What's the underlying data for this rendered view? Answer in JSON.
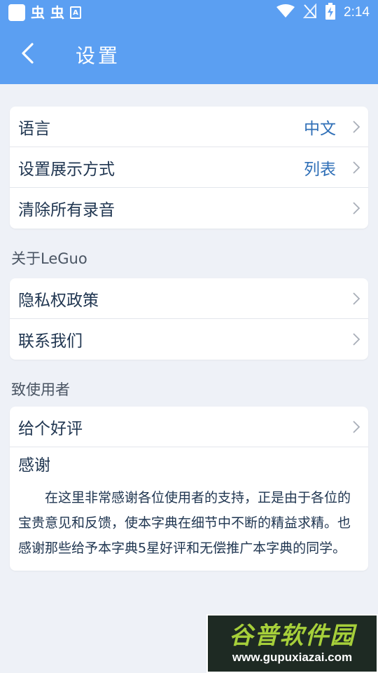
{
  "status_bar": {
    "left_glyphs": [
      "虫",
      "虫"
    ],
    "badge": "A",
    "time": "2:14"
  },
  "app_bar": {
    "title": "设置"
  },
  "settings": [
    {
      "label": "语言",
      "value": "中文"
    },
    {
      "label": "设置展示方式",
      "value": "列表"
    },
    {
      "label": "清除所有录音",
      "value": ""
    }
  ],
  "about": {
    "title": "关于LeGuo",
    "items": [
      {
        "label": "隐私权政策"
      },
      {
        "label": "联系我们"
      }
    ]
  },
  "users": {
    "title": "致使用者",
    "rate_label": "给个好评",
    "thanks_title": "感谢",
    "thanks_text": "在这里非常感谢各位使用者的支持，正是由于各位的宝贵意见和反馈，使本字典在细节中不断的精益求精。也感谢那些给予本字典5星好评和无偿推广本字典的同学。"
  },
  "watermark": {
    "title": "谷普软件园",
    "url": "www.gupuxiazai.com"
  },
  "colors": {
    "accent": "#5b9ff2",
    "value_text": "#2f6fb7",
    "background": "#eef1f7"
  },
  "icons": {
    "back": "chevron-left-icon",
    "row_arrow": "chevron-right-icon",
    "wifi": "wifi-icon",
    "signal": "no-signal-icon",
    "battery": "battery-charging-icon"
  }
}
